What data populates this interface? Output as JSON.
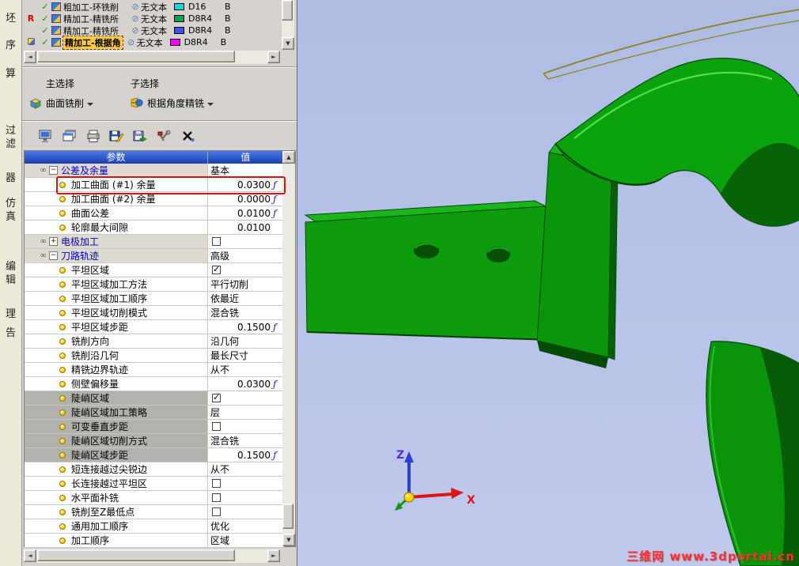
{
  "side_tabs": {
    "items": [
      {
        "label": "坯"
      },
      {
        "label": "序"
      },
      {
        "label": "算"
      },
      {
        "label": "过"
      },
      {
        "label": "滤"
      },
      {
        "label": "器"
      },
      {
        "label": "仿"
      },
      {
        "label": "真"
      },
      {
        "label": "编"
      },
      {
        "label": "辑"
      },
      {
        "label": "理"
      },
      {
        "label": "告"
      }
    ]
  },
  "operations": {
    "rows": [
      {
        "gutter": "",
        "name": "粗加工-环铣削",
        "no_text": "无文本",
        "swatch": "#00dcdc",
        "tool": "D16",
        "flag": "B",
        "selected": false
      },
      {
        "gutter": "R",
        "name": "精加工-精铣所",
        "no_text": "无文本",
        "swatch": "#00a651",
        "tool": "D8R4",
        "flag": "B",
        "selected": false
      },
      {
        "gutter": "",
        "name": "精加工-精铣所",
        "no_text": "无文本",
        "swatch": "#3c50ff",
        "tool": "D8R4",
        "flag": "B",
        "selected": false
      },
      {
        "gutter": "",
        "name": "精加工-根据角",
        "no_text": "无文本",
        "swatch": "#ff00ff",
        "tool": "D8R4",
        "flag": "B",
        "selected": true
      }
    ]
  },
  "selectors": {
    "main_label": "主选择",
    "main_value": "曲面铣削",
    "sub_label": "子选择",
    "sub_value": "根据角度精铣"
  },
  "toolbar": {
    "icons": [
      "display",
      "windows",
      "printer",
      "save-edit",
      "save-export",
      "tools",
      "delete"
    ]
  },
  "params": {
    "headers": {
      "param": "参数",
      "value": "值"
    },
    "f_label": "ƒ",
    "rows": [
      {
        "label": "公差及余量",
        "value": "基本",
        "type": "text",
        "group": true,
        "box": "−"
      },
      {
        "label": "加工曲面 (#1) 余量",
        "value": "0.0300",
        "type": "num",
        "f": true,
        "highlight": true
      },
      {
        "label": "加工曲面 (#2) 余量",
        "value": "0.0000",
        "type": "num",
        "f": true
      },
      {
        "label": "曲面公差",
        "value": "0.0100",
        "type": "num",
        "f": true
      },
      {
        "label": "轮廓最大间隙",
        "value": "0.0100",
        "type": "num",
        "f": false
      },
      {
        "label": "电极加工",
        "type": "check",
        "checked": false,
        "group": true,
        "box": "+"
      },
      {
        "label": "刀路轨迹",
        "value": "高级",
        "type": "text",
        "group": true,
        "box": "−"
      },
      {
        "label": "平坦区域",
        "type": "check",
        "checked": true
      },
      {
        "label": "平坦区域加工方法",
        "value": "平行切削",
        "type": "text"
      },
      {
        "label": "平坦区域加工顺序",
        "value": "依最近",
        "type": "text"
      },
      {
        "label": "平坦区域切削模式",
        "value": "混合铣",
        "type": "text"
      },
      {
        "label": "平坦区域步距",
        "value": "0.1500",
        "type": "num",
        "f": true
      },
      {
        "label": "铣削方向",
        "value": "沿几何",
        "type": "text"
      },
      {
        "label": "铣削沿几何",
        "value": "最长尺寸",
        "type": "text"
      },
      {
        "label": "精铣边界轨迹",
        "value": "从不",
        "type": "text"
      },
      {
        "label": "侧壁偏移量",
        "value": "0.0300",
        "type": "num",
        "f": true
      },
      {
        "label": "陡峭区域",
        "type": "check",
        "checked": true,
        "gray": true
      },
      {
        "label": "陡峭区域加工策略",
        "value": "层",
        "type": "text",
        "gray": true
      },
      {
        "label": "可变垂直步距",
        "type": "check",
        "checked": false,
        "gray": true
      },
      {
        "label": "陡峭区域切削方式",
        "value": "混合铣",
        "type": "text",
        "gray": true
      },
      {
        "label": "陡峭区域步距",
        "value": "0.1500",
        "type": "num",
        "f": true,
        "gray": true
      },
      {
        "label": "短连接越过尖锐边",
        "value": "从不",
        "type": "text"
      },
      {
        "label": "长连接越过平坦区",
        "type": "check",
        "checked": false
      },
      {
        "label": "水平面补铣",
        "type": "check",
        "checked": false
      },
      {
        "label": "铣削至Z最低点",
        "type": "check",
        "checked": false
      },
      {
        "label": "通用加工顺序",
        "value": "优化",
        "type": "text"
      },
      {
        "label": "加工顺序",
        "value": "区域",
        "type": "text"
      }
    ]
  },
  "viewport": {
    "bg": "#b4c0e6",
    "model_color": "#0c9c0c",
    "axes": {
      "z_label": "Z",
      "z_color": "#4433cc",
      "x_label": "X",
      "x_color": "#dd1111",
      "y_color": "#0a9a0a",
      "origin_color": "#ffd400"
    },
    "watermark": {
      "text": "三维网 www.3dportal.cn",
      "color": "#ff2f2f"
    }
  }
}
